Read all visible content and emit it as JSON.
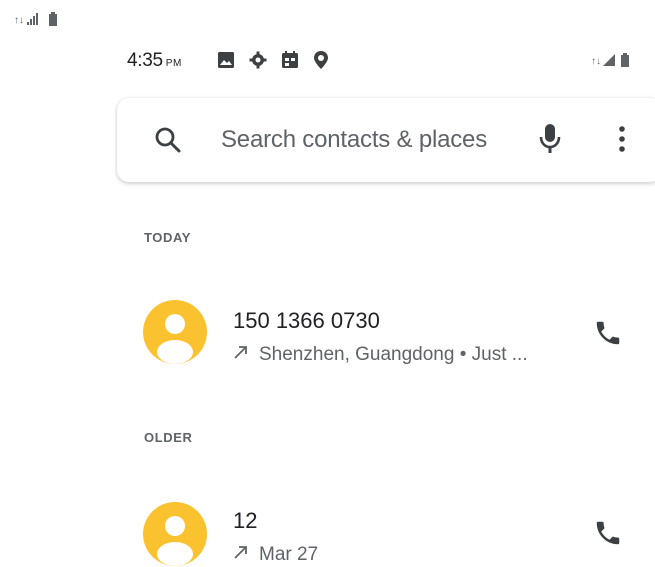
{
  "outer_status": {
    "signal_icon": "signal-icon",
    "battery_icon": "battery-icon"
  },
  "status_bar": {
    "time": "4:35",
    "ampm": "PM",
    "notification_icons": [
      "image-icon",
      "gear-icon",
      "calendar-icon",
      "location-pin-icon"
    ],
    "right_icons": [
      "signal-icon",
      "battery-icon"
    ]
  },
  "search": {
    "placeholder": "Search contacts & places",
    "left_icon": "search-icon",
    "mic_icon": "mic-icon",
    "menu_icon": "more-vert-icon"
  },
  "sections": [
    {
      "header": "TODAY",
      "items": [
        {
          "title": "150 1366 0730",
          "direction_icon": "outgoing-arrow-icon",
          "detail": "Shenzhen, Guangdong • Just ..."
        }
      ]
    },
    {
      "header": "OLDER",
      "items": [
        {
          "title": "12",
          "direction_icon": "outgoing-arrow-icon",
          "detail": "Mar 27"
        }
      ]
    }
  ],
  "colors": {
    "avatar": "#f9c22e",
    "text_primary": "#202124",
    "text_secondary": "#5f6368"
  }
}
